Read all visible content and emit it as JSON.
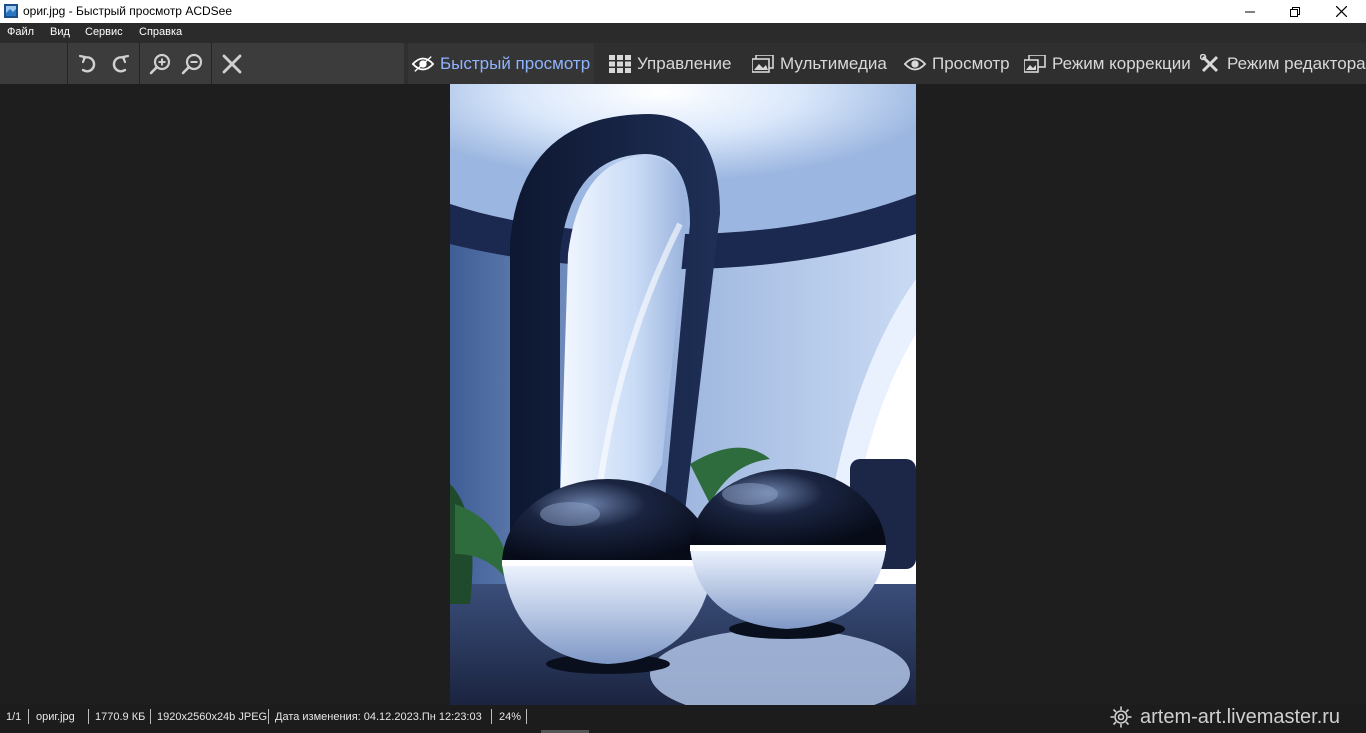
{
  "window": {
    "title": "ориг.jpg - Быстрый просмотр ACDSee"
  },
  "menu": {
    "file": "Файл",
    "view": "Вид",
    "tools": "Сервис",
    "help": "Справка"
  },
  "modes": [
    {
      "label": "Быстрый просмотр",
      "icon": "eye-icon",
      "active": true
    },
    {
      "label": "Управление",
      "icon": "grid-icon"
    },
    {
      "label": "Мультимедиа",
      "icon": "photos-icon"
    },
    {
      "label": "Просмотр",
      "icon": "eye-icon"
    },
    {
      "label": "Режим коррекции",
      "icon": "develop-icon"
    },
    {
      "label": "Режим редактора",
      "icon": "edit-tools-icon"
    }
  ],
  "status": {
    "index": "1/1",
    "filename": "ориг.jpg",
    "filesize": "1770.9 КБ",
    "dimensions": "1920x2560x24b JPEG",
    "modified": "Дата изменения: 04.12.2023.Пн 12:23:03",
    "zoom": "24%"
  },
  "watermark": "artem-art.livemaster.ru",
  "colors": {
    "accent": "#8fb3ff",
    "background": "#1e1e1e",
    "toolbar": "#3c3c3c"
  }
}
